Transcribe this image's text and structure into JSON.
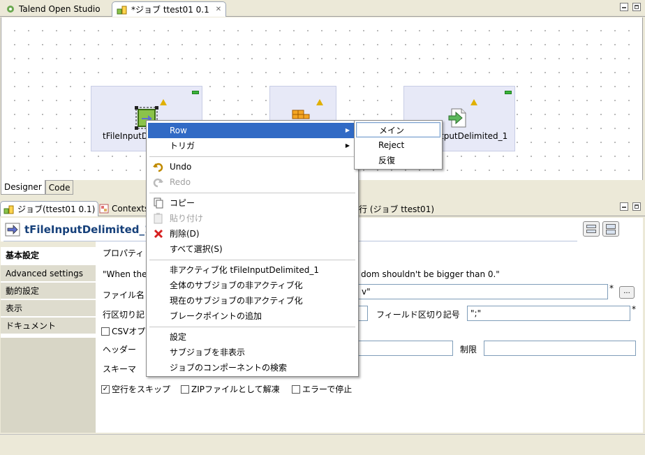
{
  "editor_tabs": {
    "studio": "Talend Open Studio",
    "job": "*ジョブ ttest01 0.1"
  },
  "canvas": {
    "components": [
      {
        "label": "tFileInputD"
      },
      {
        "label": ""
      },
      {
        "label": "tputDelimited_1"
      }
    ],
    "tabs": {
      "designer": "Designer",
      "code": "Code"
    }
  },
  "view_tabs": {
    "job": "ジョブ(ttest01 0.1)",
    "contexts": "Contexts",
    "run": "行 (ジョブ ttest01)"
  },
  "component": {
    "title": "tFileInputDelimited_1"
  },
  "left_nav": [
    "基本設定",
    "Advanced settings",
    "動的設定",
    "表示",
    "ドキュメント"
  ],
  "props": {
    "property_label": "プロパティ",
    "warning": "\"When the",
    "warning_right": "dom shouldn't be bigger than 0.\"",
    "filename_label": "ファイル名",
    "filename_value": "v\"",
    "row_sep_label": "行区切り記",
    "field_sep_label": "フィールド区切り記号",
    "field_sep_value": "\";\"",
    "csv_option": "CSVオプ",
    "header_label": "ヘッダー",
    "limit_label": "制限",
    "schema_label": "スキーマ",
    "skip_empty": "空行をスキップ",
    "skip_empty_checked": true,
    "unzip": "ZIPファイルとして解凍",
    "stop_on_error": "エラーで停止",
    "required_mark": "*",
    "browse_label": "..."
  },
  "context_menu": {
    "row": "Row",
    "trigger": "トリガ",
    "undo": "Undo",
    "redo": "Redo",
    "copy": "コピー",
    "paste": "貼り付け",
    "delete": "削除(D)",
    "select_all": "すべて選択(S)",
    "deactivate": "非アクティブ化 tFileInputDelimited_1",
    "deactivate_all": "全体のサブジョブの非アクティブ化",
    "deactivate_current": "現在のサブジョブの非アクティブ化",
    "add_breakpoint": "ブレークポイントの追加",
    "settings": "設定",
    "hide_subjob": "サブジョブを非表示",
    "search_components": "ジョブのコンポーネントの検索"
  },
  "submenu": {
    "main": "メイン",
    "reject": "Reject",
    "iterate": "反復"
  },
  "colors": {
    "highlight": "#316ac5",
    "title_text": "#16407a",
    "component_bg": "#e7e9f7"
  }
}
